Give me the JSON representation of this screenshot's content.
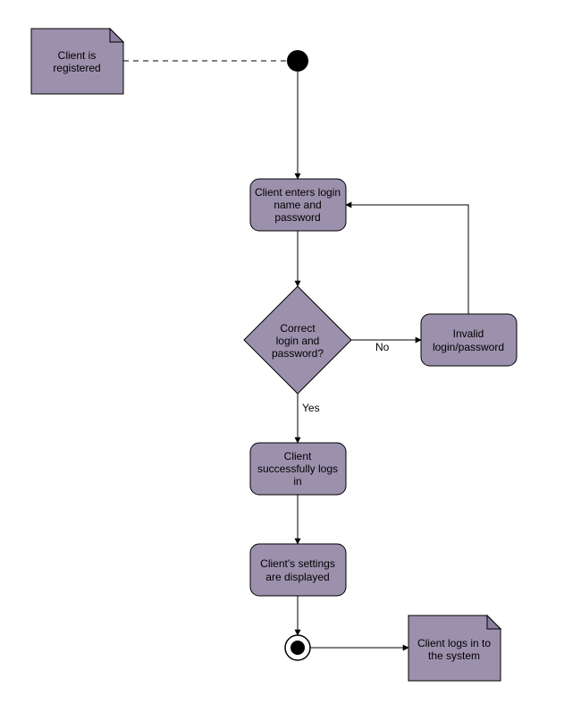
{
  "diagram": {
    "type": "activity-diagram",
    "note_start": "Client is registered",
    "action_enter": "Client enters login name and password",
    "decision": "Correct login and password?",
    "decision_yes": "Yes",
    "decision_no": "No",
    "action_invalid": "Invalid login/password",
    "action_success": "Client successfully logs in",
    "action_settings": "Client's settings are displayed",
    "note_end": "Client logs in to the system"
  }
}
